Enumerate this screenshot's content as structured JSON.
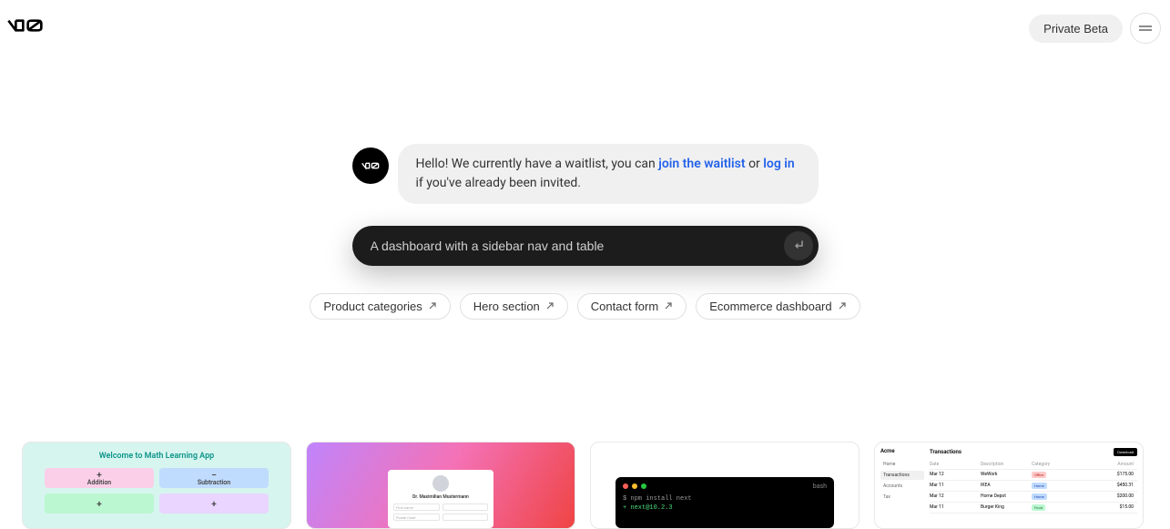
{
  "header": {
    "beta_button": "Private Beta"
  },
  "chat": {
    "text_before_link1": "Hello! We currently have a waitlist, you can ",
    "link1": "join the waitlist",
    "text_between": " or ",
    "link2": "log in",
    "text_after": " if you've already been invited."
  },
  "input": {
    "placeholder": "A dashboard with a sidebar nav and table",
    "value": "A dashboard with a sidebar nav and table"
  },
  "chips": [
    "Product categories",
    "Hero section",
    "Contact form",
    "Ecommerce dashboard"
  ],
  "card1": {
    "title": "Welcome to Math Learning App",
    "tiles": [
      "Addition",
      "Subtraction"
    ]
  },
  "card2": {
    "name": "Dr. Maximilian Mustermann",
    "fields": [
      "First name",
      "",
      "Postal Code",
      ""
    ]
  },
  "card3": {
    "label": "bash",
    "lines": [
      "$ npm install next",
      "+ next@10.2.3"
    ]
  },
  "card4": {
    "brand": "Acme",
    "nav": [
      "Home",
      "Transactions",
      "Accounts",
      "Tax"
    ],
    "title": "Transactions",
    "download": "Download",
    "columns": [
      "Date",
      "Description",
      "Category",
      "Amount"
    ],
    "rows": [
      {
        "date": "Mar 12",
        "desc": "WeWork",
        "cat": "Office",
        "catClass": "red",
        "amount": "$175.00"
      },
      {
        "date": "Mar 11",
        "desc": "IKEA",
        "cat": "Home",
        "catClass": "blue",
        "amount": "$450.31"
      },
      {
        "date": "Mar 12",
        "desc": "Home Depot",
        "cat": "Home",
        "catClass": "blue",
        "amount": "$200.00"
      },
      {
        "date": "Mar 11",
        "desc": "Burger King",
        "cat": "Food",
        "catClass": "green",
        "amount": "$15.00"
      }
    ]
  }
}
